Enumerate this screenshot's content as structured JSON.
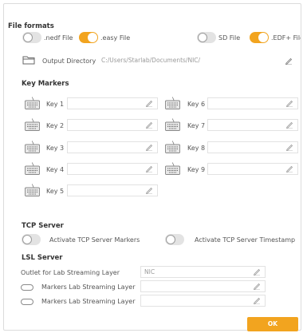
{
  "file_formats": {
    "title": "File formats",
    "items": [
      {
        "label": ".nedf File",
        "on": false
      },
      {
        "label": ".easy File",
        "on": true
      },
      {
        "label": "SD File",
        "on": false
      },
      {
        "label": ".EDF+ File",
        "on": true
      }
    ],
    "output_directory": {
      "label": "Output Directory",
      "value": "C:/Users/Starlab/Documents/NIC/"
    }
  },
  "key_markers": {
    "title": "Key Markers",
    "keys": [
      {
        "label": "Key 1",
        "value": ""
      },
      {
        "label": "Key 2",
        "value": ""
      },
      {
        "label": "Key 3",
        "value": ""
      },
      {
        "label": "Key 4",
        "value": ""
      },
      {
        "label": "Key 5",
        "value": ""
      },
      {
        "label": "Key 6",
        "value": ""
      },
      {
        "label": "Key 7",
        "value": ""
      },
      {
        "label": "Key 8",
        "value": ""
      },
      {
        "label": "Key 9",
        "value": ""
      }
    ]
  },
  "tcp_server": {
    "title": "TCP Server",
    "markers_label": "Activate TCP Server Markers",
    "timestamp_label": "Activate TCP Server Timestamp"
  },
  "lsl_server": {
    "title": "LSL Server",
    "outlet_label": "Outlet for Lab Streaming Layer",
    "outlet_placeholder": "NIC",
    "markers_label_1": "Markers Lab Streaming Layer",
    "markers_label_2": "Markers Lab Streaming Layer"
  },
  "ok_label": "OK",
  "colors": {
    "accent": "#f2a41f",
    "toggle_off": "#e3e3e3"
  }
}
